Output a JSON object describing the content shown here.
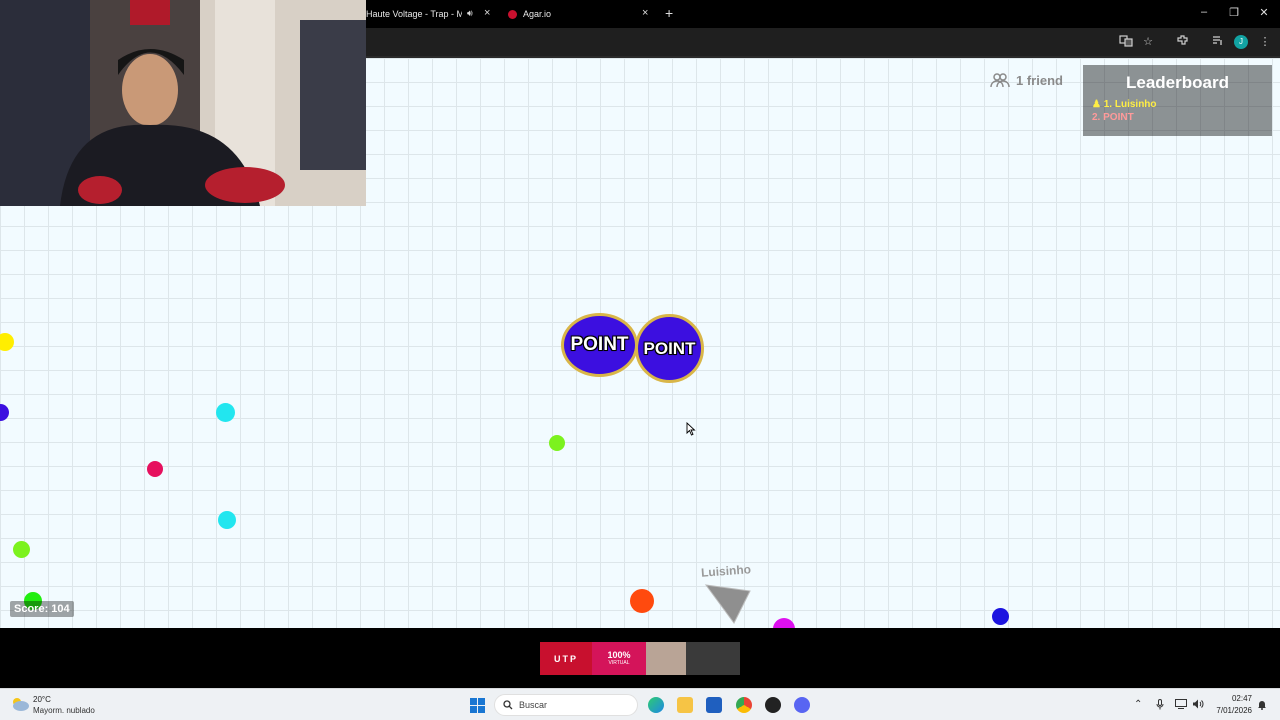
{
  "browser": {
    "tabs": [
      {
        "title": "Haute Voltage - Trap - Mús",
        "audio_icon": "speaker-icon",
        "close": "×"
      },
      {
        "title": "Agar.io",
        "favicon": "agario-favicon",
        "favicon_color": "#c8102e",
        "close": "×"
      }
    ],
    "new_tab": "+",
    "window_controls": {
      "minimize": "–",
      "restore": "❐",
      "close": "✕"
    },
    "toolbar_icons": [
      "translate-icon",
      "bookmark-star-icon",
      "extensions-icon",
      "media-control-icon",
      "profile-avatar",
      "menu-icon"
    ],
    "profile_initial": "J"
  },
  "game": {
    "friends": {
      "label": "1 friend",
      "icon": "friends-icon"
    },
    "leaderboard": {
      "title": "Leaderboard",
      "entries": [
        "1. Luisinho",
        "2. POINT"
      ],
      "self_color": "#ffee44",
      "other_color": "#ff9a9a"
    },
    "score_label": "Score: 104",
    "cells": [
      {
        "name": "POINT",
        "color": "#3c0fe0",
        "border": "#d9b648"
      },
      {
        "name": "POINT",
        "color": "#3c0fe0",
        "border": "#d9b648"
      }
    ],
    "player_name": "Luisinho",
    "food_colors": [
      "#ffee00",
      "#3c0fe0",
      "#22e6ef",
      "#e6105e",
      "#7cf21e",
      "#ff4a0e",
      "#dd10ef"
    ],
    "background_color": "#f2fbff"
  },
  "ad": {
    "brand": "UTP",
    "headline": "100%",
    "sub": "VIRTUAL"
  },
  "taskbar": {
    "weather": {
      "temp": "20°C",
      "desc": "Mayorm. nublado"
    },
    "search_placeholder": "Buscar",
    "apps": [
      "edge-icon",
      "file-explorer-icon",
      "store-icon",
      "chrome-icon",
      "obs-icon",
      "discord-icon"
    ],
    "tray_icons": [
      "chevron-up-icon",
      "microphone-icon",
      "network-icon",
      "volume-icon"
    ],
    "time": "02:47",
    "date": "7/01/2026"
  }
}
